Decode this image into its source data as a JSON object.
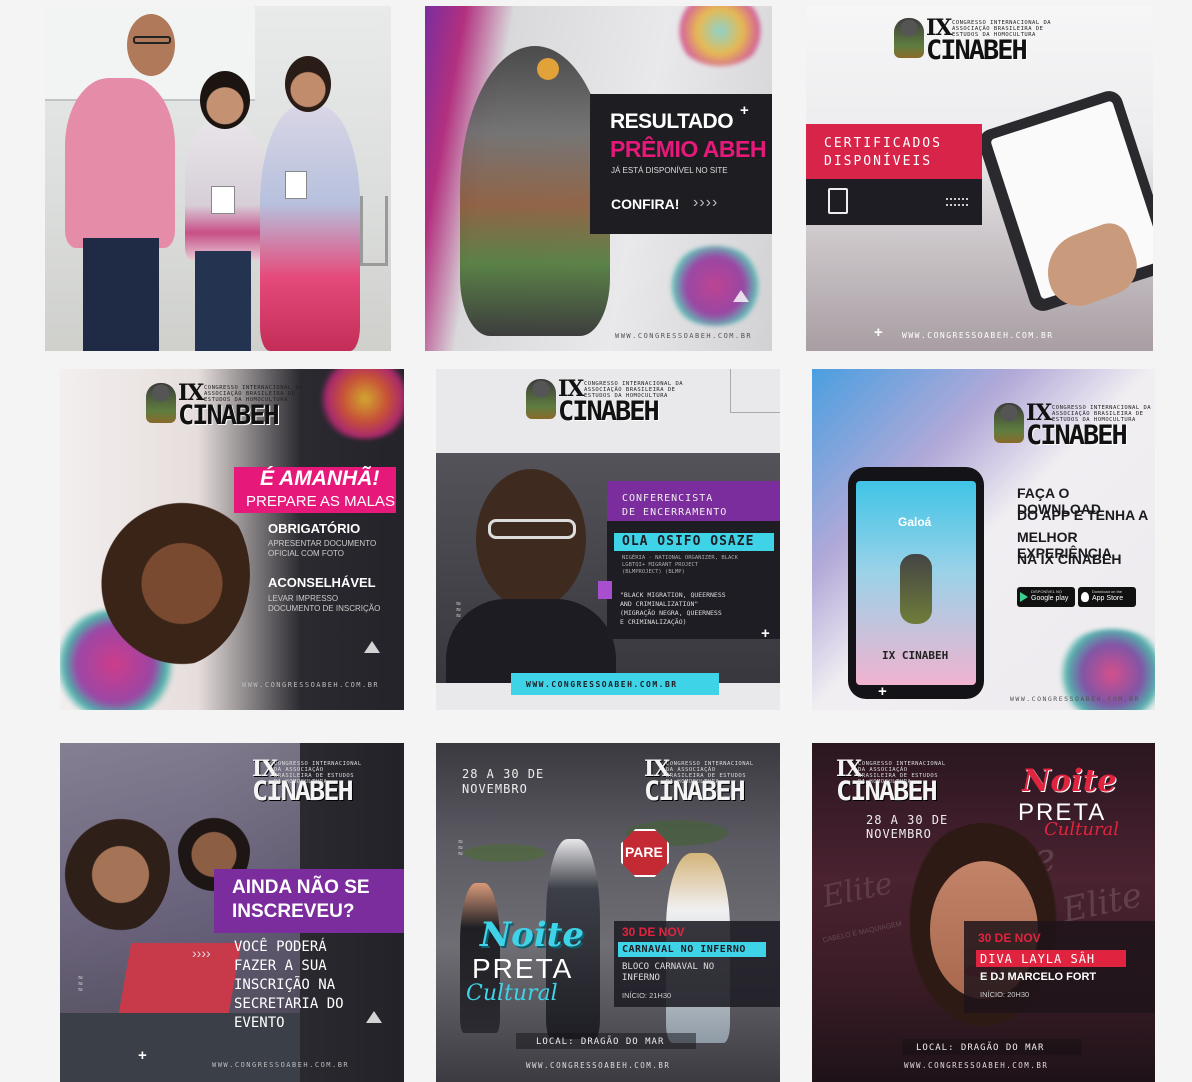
{
  "tiles": {
    "t1": {},
    "t2": {
      "title_1": "RESULTADO",
      "title_2": "PRÊMIO ABEH",
      "subtitle": "JÁ ESTÁ DISPONÍVEL NO SITE",
      "cta": "CONFIRA!",
      "arrows": "››››",
      "site": "WWW.CONGRESSOABEH.COM.BR"
    },
    "t3": {
      "logo_ix": "IX",
      "logo_name": "CINABEH",
      "logo_sub": "CONGRESSO INTERNACIONAL DA ASSOCIAÇÃO BRASILEIRA DE ESTUDOS DA HOMOCULTURA",
      "banner_1": "CERTIFICADOS",
      "banner_2": "DISPONÍVEIS",
      "site": "WWW.CONGRESSOABEH.COM.BR"
    },
    "t4": {
      "logo_ix": "IX",
      "logo_name": "CINABEH",
      "logo_sub": "CONGRESSO INTERNACIONAL DA ASSOCIAÇÃO BRASILEIRA DE ESTUDOS DA HOMOCULTURA",
      "headline_1": "É AMANHÃ!",
      "headline_2": "PREPARE AS MALAS",
      "item1_title": "OBRIGATÓRIO",
      "item1_text_1": "APRESENTAR DOCUMENTO",
      "item1_text_2": "OFICIAL COM FOTO",
      "item2_title": "ACONSELHÁVEL",
      "item2_text_1": "LEVAR IMPRESSO",
      "item2_text_2": "DOCUMENTO DE INSCRIÇÃO",
      "site": "WWW.CONGRESSOABEH.COM.BR"
    },
    "t5": {
      "logo_ix": "IX",
      "logo_name": "CINABEH",
      "logo_sub": "CONGRESSO INTERNACIONAL DA ASSOCIAÇÃO BRASILEIRA DE ESTUDOS DA HOMOCULTURA",
      "role_1": "CONFERENCISTA",
      "role_2": "DE ENCERRAMENTO",
      "speaker": "OLA OSIFO OSAZE",
      "bio_1": "NIGÉRIA · NATIONAL ORGANIZER, BLACK",
      "bio_2": "LGBTQI+ MIGRANT PROJECT",
      "bio_3": "(BLMPROJECT) (BLMP)",
      "talk_1": "\"BLACK MIGRATION, QUEERNESS",
      "talk_2": "AND CRIMINALIZATION\"",
      "talk_3": "(MIGRAÇÃO NEGRA, QUEERNESS",
      "talk_4": "E CRIMINALIZAÇÃO)",
      "site": "WWW.CONGRESSOABEH.COM.BR"
    },
    "t6": {
      "logo_ix": "IX",
      "logo_name": "CINABEH",
      "logo_sub": "CONGRESSO INTERNACIONAL DA ASSOCIAÇÃO BRASILEIRA DE ESTUDOS DA HOMOCULTURA",
      "app_name": "Galoá",
      "screen_logo": "IX CINABEH",
      "text_1": "FAÇA O DOWNLOAD",
      "text_2": "DO APP E TENHA A",
      "text_3": "MELHOR EXPERIÊNCIA",
      "text_4": "NA IX CINABEH",
      "google_small": "DISPONÍVEL NO",
      "google_big": "Google play",
      "apple_small": "Download on the",
      "apple_big": "App Store",
      "site": "WWW.CONGRESSOABEH.COM.BR"
    },
    "t7": {
      "logo_ix": "IX",
      "logo_name": "CINABEH",
      "logo_sub": "CONGRESSO INTERNACIONAL DA ASSOCIAÇÃO BRASILEIRA DE ESTUDOS DA HOMOCULTURA",
      "headline_1": "AINDA NÃO SE",
      "headline_2": "INSCREVEU?",
      "arrows": "››››",
      "body_1": "VOCÊ PODERÁ",
      "body_2": "FAZER A SUA",
      "body_3": "INSCRIÇÃO NA",
      "body_4": "SECRETARIA DO",
      "body_5": "EVENTO",
      "site": "WWW.CONGRESSOABEH.COM.BR"
    },
    "t8": {
      "dates_1": "28 A 30 DE",
      "dates_2": "NOVEMBRO",
      "logo_ix": "IX",
      "logo_name": "CINABEH",
      "logo_sub": "CONGRESSO INTERNACIONAL DA ASSOCIAÇÃO BRASILEIRA DE ESTUDOS DA HOMOCULTURA",
      "sign": "PARE",
      "noite": "Noite",
      "preta": "PRETA",
      "cultural": "Cultural",
      "date": "30 DE NOV",
      "event": "CARNAVAL NO INFERNO",
      "detail_1": "BLOCO CARNAVAL NO",
      "detail_2": "INFERNO",
      "time": "INÍCIO: 21H30",
      "local": "LOCAL: DRAGÃO DO MAR",
      "site": "WWW.CONGRESSOABEH.COM.BR"
    },
    "t9": {
      "logo_ix": "IX",
      "logo_name": "CINABEH",
      "logo_sub": "CONGRESSO INTERNACIONAL DA ASSOCIAÇÃO BRASILEIRA DE ESTUDOS DA HOMOCULTURA",
      "dates_1": "28 A 30 DE",
      "dates_2": "NOVEMBRO",
      "noite": "Noite",
      "preta": "PRETA",
      "cultural": "Cultural",
      "date": "30 DE NOV",
      "performer": "DIVA LAYLA SÂH",
      "dj": "E DJ MARCELO FORT",
      "time": "INÍCIO: 20H30",
      "local": "LOCAL: DRAGÃO DO MAR",
      "site": "WWW.CONGRESSOABEH.COM.BR",
      "bg_word_1": "Elite",
      "bg_word_2": "CABELO E MAQUIAGEM"
    }
  },
  "colors": {
    "pink": "#e6197b",
    "purple": "#7b2d9e",
    "cyan": "#3fd3e8",
    "red": "#e0243f",
    "dark": "#1c1b22"
  }
}
